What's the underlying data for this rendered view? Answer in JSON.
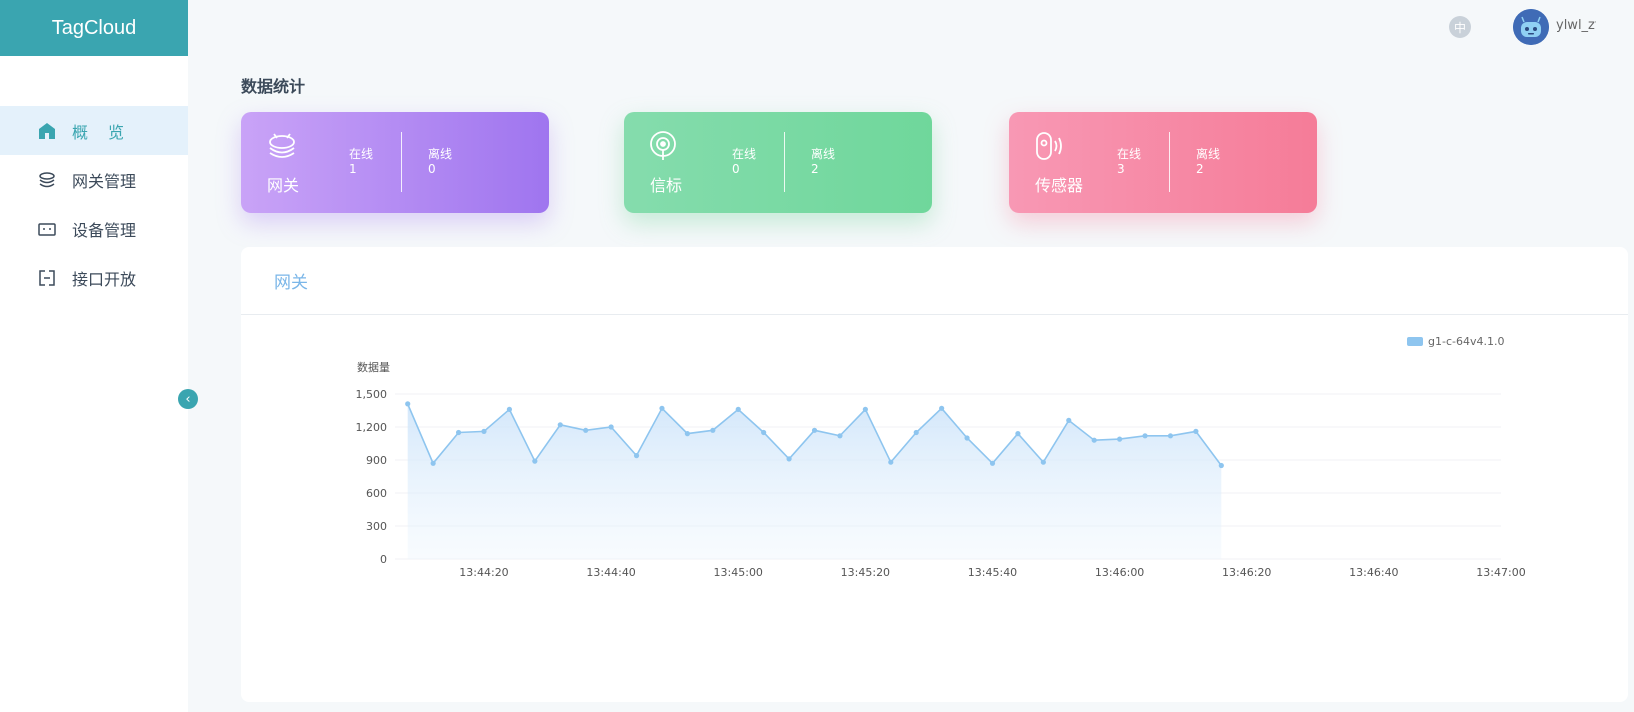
{
  "app": {
    "title": "TagCloud"
  },
  "sidebar": {
    "items": [
      {
        "label": "概览",
        "icon": "home-icon"
      },
      {
        "label": "网关管理",
        "icon": "gateway-icon"
      },
      {
        "label": "设备管理",
        "icon": "device-icon"
      },
      {
        "label": "接口开放",
        "icon": "api-icon"
      }
    ],
    "collapse_glyph": "‹"
  },
  "header": {
    "lang": "中",
    "username": "ylwl_zt"
  },
  "stats": {
    "title": "数据统计",
    "cards": [
      {
        "name": "网关",
        "online_label": "在线",
        "online": "1",
        "offline_label": "离线",
        "offline": "0",
        "icon": "gateway-icon"
      },
      {
        "name": "信标",
        "online_label": "在线",
        "online": "0",
        "offline_label": "离线",
        "offline": "2",
        "icon": "beacon-icon"
      },
      {
        "name": "传感器",
        "online_label": "在线",
        "online": "3",
        "offline_label": "离线",
        "offline": "2",
        "icon": "sensor-icon"
      }
    ]
  },
  "chart_panel": {
    "title": "网关"
  },
  "chart_data": {
    "type": "area",
    "ylabel": "数据量",
    "ylim": [
      0,
      1500
    ],
    "yticks": [
      "0",
      "300",
      "600",
      "900",
      "1,200",
      "1,500"
    ],
    "xlim": [
      "13:44:06",
      "13:47:00"
    ],
    "xticks": [
      "13:44:20",
      "13:44:40",
      "13:45:00",
      "13:45:20",
      "13:45:40",
      "13:46:00",
      "13:46:20",
      "13:46:40",
      "13:47:00"
    ],
    "legend_position": "top-right",
    "series": [
      {
        "name": "g1-c-64v4.1.0",
        "color": "#8ec5ef",
        "points": [
          [
            "13:44:08",
            1410
          ],
          [
            "13:44:12",
            870
          ],
          [
            "13:44:16",
            1150
          ],
          [
            "13:44:20",
            1160
          ],
          [
            "13:44:24",
            1360
          ],
          [
            "13:44:28",
            890
          ],
          [
            "13:44:32",
            1220
          ],
          [
            "13:44:36",
            1170
          ],
          [
            "13:44:40",
            1200
          ],
          [
            "13:44:44",
            940
          ],
          [
            "13:44:48",
            1370
          ],
          [
            "13:44:52",
            1140
          ],
          [
            "13:44:56",
            1170
          ],
          [
            "13:45:00",
            1360
          ],
          [
            "13:45:04",
            1150
          ],
          [
            "13:45:08",
            910
          ],
          [
            "13:45:12",
            1170
          ],
          [
            "13:45:16",
            1120
          ],
          [
            "13:45:20",
            1360
          ],
          [
            "13:45:24",
            880
          ],
          [
            "13:45:28",
            1150
          ],
          [
            "13:45:32",
            1370
          ],
          [
            "13:45:36",
            1100
          ],
          [
            "13:45:40",
            870
          ],
          [
            "13:45:44",
            1140
          ],
          [
            "13:45:48",
            880
          ],
          [
            "13:45:52",
            1260
          ],
          [
            "13:45:56",
            1080
          ],
          [
            "13:46:00",
            1090
          ],
          [
            "13:46:04",
            1120
          ],
          [
            "13:46:08",
            1120
          ],
          [
            "13:46:12",
            1160
          ],
          [
            "13:46:16",
            850
          ]
        ]
      }
    ]
  }
}
